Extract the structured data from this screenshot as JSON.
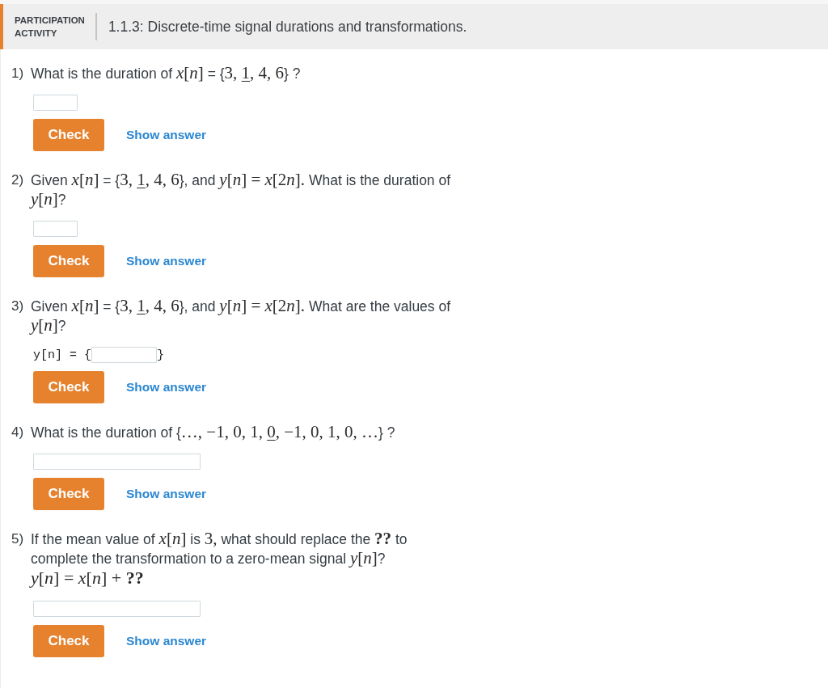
{
  "header": {
    "label": "PARTICIPATION ACTIVITY",
    "title": "1.1.3: Discrete-time signal durations and transformations."
  },
  "questions": [
    {
      "number": "1)",
      "prompt": [
        {
          "kind": "text",
          "text": "What is the duration of "
        },
        {
          "kind": "math",
          "text": "*x*[*n*]"
        },
        {
          "kind": "text",
          "text": " = {"
        },
        {
          "kind": "math",
          "text": "3, "
        },
        {
          "kind": "underlined",
          "text": "1"
        },
        {
          "kind": "math",
          "text": ", 4, 6"
        },
        {
          "kind": "text",
          "text": "} ?"
        }
      ],
      "answer": {
        "kind": "short"
      },
      "check_label": "Check",
      "show_answer_label": "Show answer"
    },
    {
      "number": "2)",
      "prompt": [
        {
          "kind": "text",
          "text": "Given "
        },
        {
          "kind": "math",
          "text": "*x*[*n*]"
        },
        {
          "kind": "text",
          "text": " = {"
        },
        {
          "kind": "math",
          "text": "3, "
        },
        {
          "kind": "underlined",
          "text": "1"
        },
        {
          "kind": "math",
          "text": ", 4, 6"
        },
        {
          "kind": "text",
          "text": "}, and "
        },
        {
          "kind": "math",
          "text": "*y*[*n*] = *x*[2"
        },
        {
          "kind": "math",
          "text": "*n*]."
        },
        {
          "kind": "text",
          "text": " What is the duration of "
        },
        {
          "kind": "math",
          "text": "*y*[*n*]"
        },
        {
          "kind": "text",
          "text": "?"
        }
      ],
      "answer": {
        "kind": "short"
      },
      "check_label": "Check",
      "show_answer_label": "Show answer"
    },
    {
      "number": "3)",
      "prompt": [
        {
          "kind": "text",
          "text": "Given "
        },
        {
          "kind": "math",
          "text": "*x*[*n*]"
        },
        {
          "kind": "text",
          "text": " = {"
        },
        {
          "kind": "math",
          "text": "3, "
        },
        {
          "kind": "underlined",
          "text": "1"
        },
        {
          "kind": "math",
          "text": ", 4, 6"
        },
        {
          "kind": "text",
          "text": "}, and "
        },
        {
          "kind": "math",
          "text": "*y*[*n*] = *x*[2"
        },
        {
          "kind": "math",
          "text": "*n*]."
        },
        {
          "kind": "text",
          "text": " What are the values of "
        },
        {
          "kind": "math",
          "text": "*y*[*n*]"
        },
        {
          "kind": "text",
          "text": "?"
        }
      ],
      "answer": {
        "kind": "braced",
        "prefix": "y[n] = {",
        "suffix": "}"
      },
      "check_label": "Check",
      "show_answer_label": "Show answer"
    },
    {
      "number": "4)",
      "prompt": [
        {
          "kind": "text",
          "text": "What is the duration of {"
        },
        {
          "kind": "math",
          "text": "…, −1, 0, 1, "
        },
        {
          "kind": "underlined",
          "text": "0"
        },
        {
          "kind": "math",
          "text": ", −1, 0, 1, 0, …"
        },
        {
          "kind": "text",
          "text": "} ?"
        }
      ],
      "answer": {
        "kind": "wide"
      },
      "check_label": "Check",
      "show_answer_label": "Show answer"
    },
    {
      "number": "5)",
      "prompt": [
        {
          "kind": "text",
          "text": "If the mean value of "
        },
        {
          "kind": "math",
          "text": "*x*[*n*]"
        },
        {
          "kind": "text",
          "text": " is "
        },
        {
          "kind": "math",
          "text": "3,"
        },
        {
          "kind": "text",
          "text": " what should replace the "
        },
        {
          "kind": "math",
          "text": "**??**"
        },
        {
          "kind": "text",
          "text": " to complete the transformation to a zero-mean signal "
        },
        {
          "kind": "math",
          "text": "*y*[*n*]"
        },
        {
          "kind": "text",
          "text": "?"
        }
      ],
      "formula": [
        {
          "kind": "math",
          "text": "*y*[*n*] = *x*[*n*] + **??**"
        }
      ],
      "answer": {
        "kind": "wide"
      },
      "check_label": "Check",
      "show_answer_label": "Show answer"
    }
  ]
}
